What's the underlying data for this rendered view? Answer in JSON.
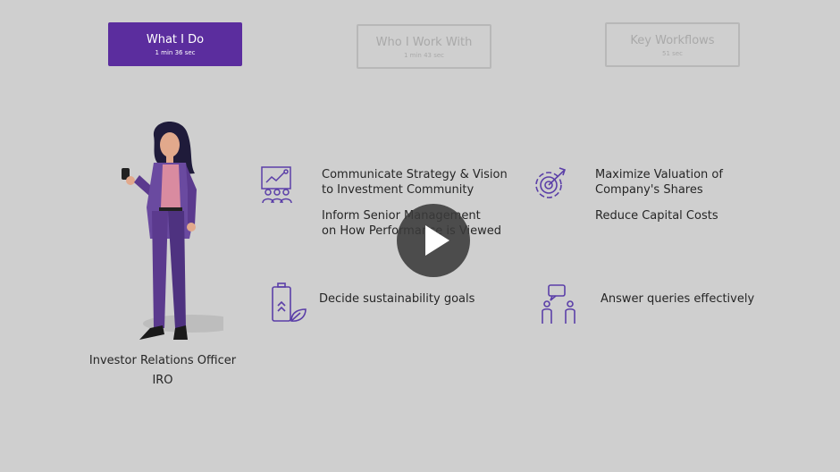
{
  "tabs": [
    {
      "label": "What I Do",
      "duration": "1 min 36 sec"
    },
    {
      "label": "Who I Work With",
      "duration": "1 min 43 sec"
    },
    {
      "label": "Key Workflows",
      "duration": "51 sec"
    }
  ],
  "items": {
    "strategy": {
      "line1": "Communicate Strategy & Vision",
      "line2": "to Investment Community"
    },
    "inform": {
      "line1": "Inform Senior Management",
      "line2": "on How Performance is Viewed"
    },
    "valuation": {
      "line1": "Maximize Valuation of",
      "line2": "Company's Shares"
    },
    "capital": "Reduce Capital Costs",
    "sustainability": "Decide sustainability goals",
    "queries": "Answer queries effectively"
  },
  "persona": {
    "title": "Investor Relations Officer",
    "abbr": "IRO"
  },
  "colors": {
    "accent": "#5b2d9e",
    "icon": "#5b3fa8",
    "background": "#cfcfcf"
  },
  "icons": [
    "presentation-audience-icon",
    "target-gear-icon",
    "sustainable-battery-icon",
    "chat-people-icon",
    "play-icon"
  ]
}
